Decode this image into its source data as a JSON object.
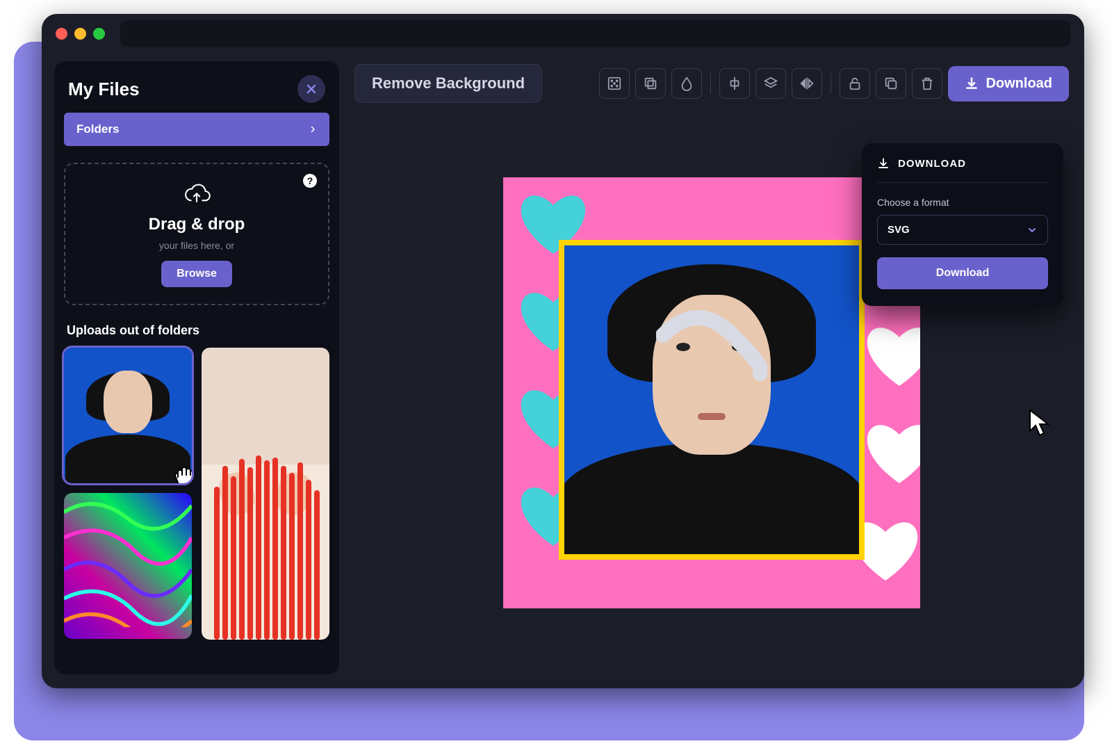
{
  "colors": {
    "accent": "#6a62cc",
    "panel": "#0d0f19",
    "window": "#1b1d28"
  },
  "sidebar": {
    "title": "My Files",
    "folders_label": "Folders",
    "dropzone": {
      "title": "Drag & drop",
      "subtitle": "your files here, or",
      "browse_label": "Browse",
      "help": "?"
    },
    "uploads_label": "Uploads out of folders"
  },
  "toolbar": {
    "remove_bg_label": "Remove Background",
    "icons": [
      "background-pattern-icon",
      "duplicate-icon",
      "opacity-drop-icon",
      "align-center-icon",
      "layers-icon",
      "flip-horizontal-icon",
      "unlock-icon",
      "copy-icon",
      "trash-icon"
    ],
    "download_label": "Download"
  },
  "download_panel": {
    "heading": "DOWNLOAD",
    "format_label": "Choose a format",
    "selected_format": "SVG",
    "confirm_label": "Download"
  }
}
